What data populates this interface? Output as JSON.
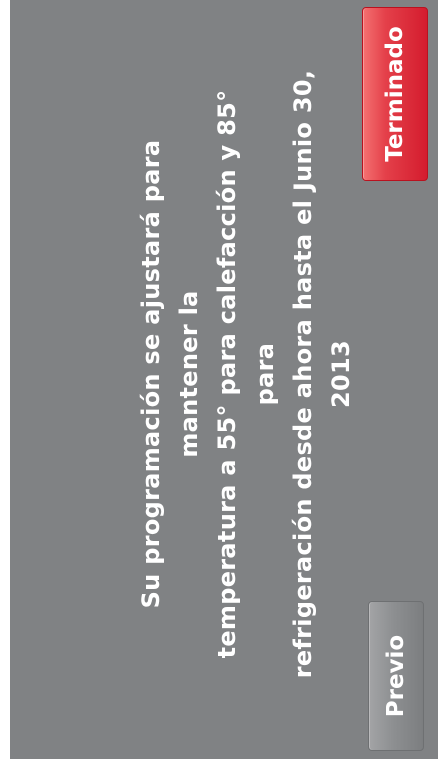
{
  "message": {
    "line1": "Su programación se ajustará para mantener la",
    "line2": "temperatura a 55° para calefacción y 85° para",
    "line3": "refrigeración desde ahora hasta el Junio 30, 2013"
  },
  "buttons": {
    "previous_label": "Previo",
    "done_label": "Terminado"
  },
  "colors": {
    "screen_background": "#808284",
    "done_button": "#d41c2e",
    "previous_button": "#8d8f91",
    "text": "#ffffff"
  }
}
